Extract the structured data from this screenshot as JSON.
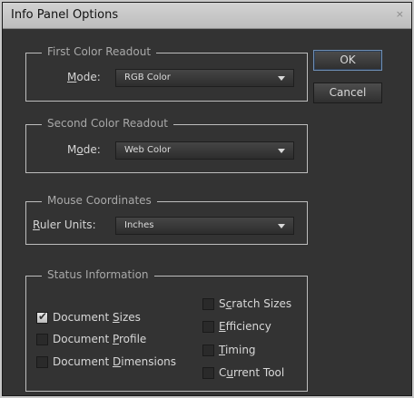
{
  "window": {
    "title": "Info Panel Options",
    "close_glyph": "×"
  },
  "buttons": {
    "ok_label": "OK",
    "cancel_label": "Cancel"
  },
  "first_readout": {
    "legend": "First Color Readout",
    "mode_label_pre": "",
    "mode_label_mnemonic": "M",
    "mode_label_post": "ode:",
    "mode_value": "RGB Color"
  },
  "second_readout": {
    "legend": "Second Color Readout",
    "mode_label_pre": "M",
    "mode_label_mnemonic": "o",
    "mode_label_post": "de:",
    "mode_value": "Web Color"
  },
  "mouse_coordinates": {
    "legend": "Mouse Coordinates",
    "units_label_pre": "",
    "units_label_mnemonic": "R",
    "units_label_post": "uler Units:",
    "units_value": "Inches"
  },
  "status_information": {
    "legend": "Status Information",
    "items": [
      {
        "pre": "Document ",
        "mnemonic": "S",
        "post": "izes",
        "checked": true
      },
      {
        "pre": "Document ",
        "mnemonic": "P",
        "post": "rofile",
        "checked": false
      },
      {
        "pre": "Document ",
        "mnemonic": "D",
        "post": "imensions",
        "checked": false
      },
      {
        "pre": "S",
        "mnemonic": "c",
        "post": "ratch Sizes",
        "checked": false
      },
      {
        "pre": "",
        "mnemonic": "E",
        "post": "fficiency",
        "checked": false
      },
      {
        "pre": "",
        "mnemonic": "T",
        "post": "iming",
        "checked": false
      },
      {
        "pre": "C",
        "mnemonic": "u",
        "post": "rrent Tool",
        "checked": false
      }
    ]
  },
  "icons": {
    "checkmark": "✔",
    "close": "close-icon",
    "dropdown": "chevron-down-icon"
  },
  "colors": {
    "panel_bg": "#333333",
    "title_bar": "#c9c9c9",
    "text": "#d8d8d8",
    "legend_text": "#a9a9a9",
    "default_button_border": "#6f8fb5"
  }
}
